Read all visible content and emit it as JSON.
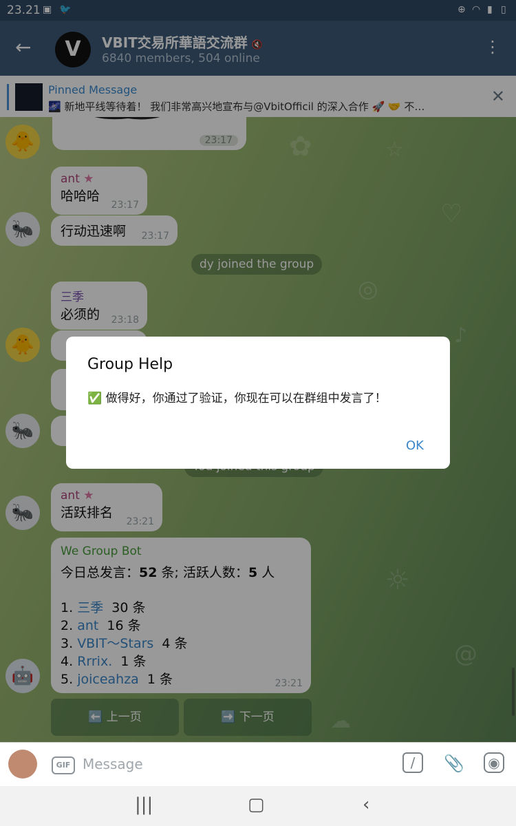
{
  "status_bar": {
    "time": "23.21"
  },
  "header": {
    "title": "VBIT交易所華語交流群",
    "subtitle": "6840 members, 504 online"
  },
  "pinned": {
    "title": "Pinned Message",
    "text": "🌌 新地平线等待着！ 我们非常高兴地宣布与@VbitOfficil 的深入合作 🚀 🤝 不…"
  },
  "messages": [
    {
      "time": "23:17"
    },
    {
      "sender": "ant",
      "text": "哈哈哈",
      "time": "23:17"
    },
    {
      "text": "行动迅速啊",
      "time": "23:17"
    },
    {
      "sender": "三季",
      "text": "必须的",
      "time": "23:18"
    },
    {
      "sender": "ant",
      "text": "活跃排名",
      "time": "23:21"
    }
  ],
  "service_messages": [
    "dy joined the group",
    "You joined this group"
  ],
  "bot_message": {
    "sender": "We Group Bot",
    "summary_a": "今日总发言：",
    "summary_count": "52",
    "summary_b": " 条; 活跃人数：",
    "summary_people": "5",
    "summary_c": " 人",
    "ranking": [
      {
        "rank": "1.",
        "name": "三季",
        "count": "30 条"
      },
      {
        "rank": "2.",
        "name": "ant",
        "count": "16 条"
      },
      {
        "rank": "3.",
        "name": "VBIT～Stars",
        "count": "4 条"
      },
      {
        "rank": "4.",
        "name": "Rrrix.",
        "count": "1 条"
      },
      {
        "rank": "5.",
        "name": "joiceahza",
        "count": "1 条"
      }
    ],
    "time": "23:21"
  },
  "keyboard": {
    "prev": "⬅️ 上一页",
    "next": "➡️ 下一页"
  },
  "dialog": {
    "title": "Group Help",
    "body": "✅ 做得好，你通过了验证，你现在可以在群组中发言了！",
    "ok": "OK"
  },
  "composer": {
    "placeholder": "Message",
    "gif": "GIF"
  },
  "colors": {
    "header_bg": "#3c5a78",
    "accent_blue": "#3b86c9",
    "bot_green": "#4a9b3d",
    "sender_ant": "#b0457c",
    "sender_sanji": "#7b4fb0"
  }
}
